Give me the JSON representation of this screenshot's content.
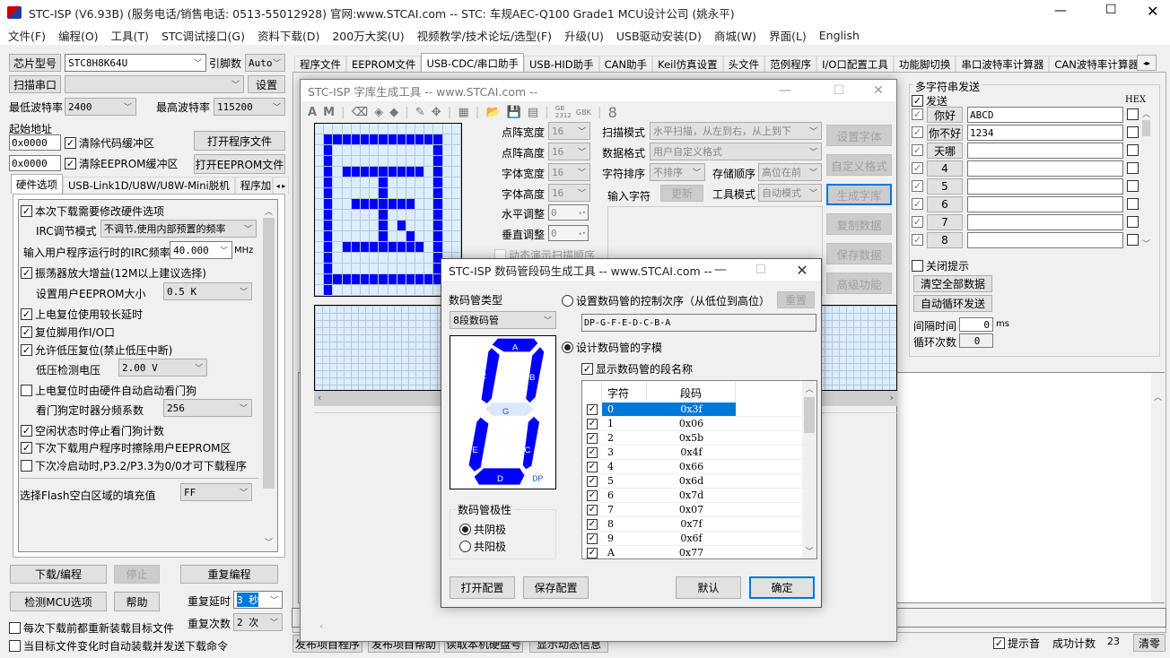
{
  "window": {
    "title": "STC-ISP (V6.93B) (服务电话/销售电话: 0513-55012928) 官网:www.STCAI.com  -- STC: 车规AEC-Q100 Grade1 MCU设计公司 (姚永平)"
  },
  "menu": [
    "文件(F)",
    "编程(O)",
    "工具(T)",
    "STC调试接口(G)",
    "资料下载(D)",
    "200万大奖(U)",
    "视频教学/技术论坛/选型(F)",
    "升级(U)",
    "USB驱动安装(D)",
    "商城(W)",
    "界面(L)",
    "English"
  ],
  "left": {
    "chip_btn": "芯片型号",
    "chip_value": "STC8H8K64U",
    "pins_label": "引脚数",
    "pins_value": "Auto",
    "scan_btn": "扫描串口",
    "port_value": "",
    "settings_btn": "设置",
    "min_baud_label": "最低波特率",
    "min_baud": "2400",
    "max_baud_label": "最高波特率",
    "max_baud": "115200",
    "start_addr_label": "起始地址",
    "addr1": "0x0000",
    "addr2": "0x0000",
    "clear_code": "清除代码缓冲区",
    "clear_eeprom": "清除EEPROM缓冲区",
    "open_prog": "打开程序文件",
    "open_eeprom": "打开EEPROM文件",
    "tabs": [
      "硬件选项",
      "USB-Link1D/U8W/U8W-Mini脱机",
      "程序加"
    ],
    "opt": {
      "o1": "本次下载需要修改硬件选项",
      "irc_mode_label": "IRC调节模式",
      "irc_mode": "不调节,使用内部预置的频率",
      "irc_freq_label": "输入用户程序运行时的IRC频率",
      "irc_freq": "40.000",
      "mhz": "MHz",
      "o2": "振荡器放大增益(12M以上建议选择)",
      "eeprom_label": "设置用户EEPROM大小",
      "eeprom": "0.5 K",
      "o3": "上电复位使用较长延时",
      "o4": "复位脚用作I/O口",
      "o5": "允许低压复位(禁止低压中断)",
      "lv_label": "低压检测电压",
      "lv": "2.00 V",
      "o6": "上电复位时由硬件自动启动看门狗",
      "wdt_label": "看门狗定时器分频系数",
      "wdt": "256",
      "o7": "空闲状态时停止看门狗计数",
      "o8": "下次下载用户程序时擦除用户EEPROM区",
      "o9": "下次冷启动时,P3.2/P3.3为0/0才可下载程序",
      "fill_label": "选择Flash空白区域的填充值",
      "fill": "FF"
    },
    "download": "下载/编程",
    "stop": "停止",
    "repeat_prog": "重复编程",
    "detect": "检测MCU选项",
    "help": "帮助",
    "repeat_delay_label": "重复延时",
    "repeat_delay": "3 秒",
    "repeat_count_label": "重复次数",
    "repeat_count": "2 次",
    "reload": "每次下载前都重新装载目标文件",
    "auto_load": "当目标文件变化时自动装载并发送下载命令"
  },
  "tabs": [
    "程序文件",
    "EEPROM文件",
    "USB-CDC/串口助手",
    "USB-HID助手",
    "CAN助手",
    "Keil仿真设置",
    "头文件",
    "范例程序",
    "I/O口配置工具",
    "功能脚切换",
    "串口波特率计算器",
    "CAN波特率计算器"
  ],
  "multi": {
    "title": "多字符串发送",
    "send": "发送",
    "hex": "HEX",
    "rows": [
      {
        "btn": "你好",
        "value": "ABCD"
      },
      {
        "btn": "你不好",
        "value": "1234"
      },
      {
        "btn": "天哪",
        "value": ""
      },
      {
        "btn": "4",
        "value": ""
      },
      {
        "btn": "5",
        "value": ""
      },
      {
        "btn": "6",
        "value": ""
      },
      {
        "btn": "7",
        "value": ""
      },
      {
        "btn": "8",
        "value": ""
      }
    ],
    "close_tip": "关闭提示",
    "clear_all": "清空全部数据",
    "auto_loop": "自动循环发送",
    "interval_label": "间隔时间",
    "interval": "0",
    "ms": "ms",
    "loop_label": "循环次数",
    "loop": "0"
  },
  "bottom": {
    "b1": "发布项目程序",
    "b2": "发布项目帮助",
    "b3": "读取本机硬盘号",
    "b4": "显示动态信息",
    "beep": "提示音",
    "success_label": "成功计数",
    "success": "23",
    "clear": "清零"
  },
  "font": {
    "title": "STC-ISP 字库生成工具 -- www.STCAI.com --",
    "tb": {
      "gb": "GB 2312",
      "gbk": "GBK"
    },
    "w_label": "点阵宽度",
    "w": "16",
    "h_label": "点阵高度",
    "h": "16",
    "fw_label": "字体宽度",
    "fw": "16",
    "fh_label": "字体高度",
    "fh": "16",
    "hadj_label": "水平调整",
    "hadj": "0",
    "vadj_label": "垂直调整",
    "vadj": "0",
    "demo": "动态演示扫描顺序",
    "scan_label": "扫描模式",
    "scan": "水平扫描，从左到右，从上到下",
    "fmt_label": "数据格式",
    "fmt": "用户自定义格式",
    "sort_label": "字符排序",
    "sort": "不排序",
    "order_label": "存储顺序",
    "order": "高位在前",
    "input_label": "输入字符",
    "refresh": "更新",
    "mode_label": "工具模式",
    "mode": "自动模式",
    "btns": [
      "设置字体",
      "自定义格式",
      "生成字库",
      "复制数据",
      "保存数据",
      "高级功能"
    ],
    "bitmap": [
      "0000000000000000",
      "0111111111111100",
      "0100000000000100",
      "0100000000000100",
      "0101111111110100",
      "0100000100000100",
      "0100000100000100",
      "0100111111100100",
      "0100000100000100",
      "0100000101000100",
      "0100000100100100",
      "0101111111110100",
      "0100000000000100",
      "0100000000000100",
      "0111111111111100",
      "0100000000000000"
    ]
  },
  "seg": {
    "title": "STC-ISP 数码管段码生成工具 -- www.STCAI.com --",
    "type_label": "数码管类型",
    "type": "8段数码管",
    "order_radio": "设置数码管的控制次序（从低位到高位）",
    "reset": "重置",
    "order": "DP-G-F-E-D-C-B-A",
    "design_radio": "设计数码管的字模",
    "show_names": "显示数码管的段名称",
    "segments": {
      "A": "A",
      "B": "B",
      "C": "C",
      "D": "D",
      "E": "E",
      "F": "F",
      "G": "G",
      "DP": "DP"
    },
    "seg_on": "#0000ff",
    "seg_off": "#dde9fb",
    "col_char": "字符",
    "col_code": "段码",
    "rows": [
      [
        "0",
        "0x3f"
      ],
      [
        "1",
        "0x06"
      ],
      [
        "2",
        "0x5b"
      ],
      [
        "3",
        "0x4f"
      ],
      [
        "4",
        "0x66"
      ],
      [
        "5",
        "0x6d"
      ],
      [
        "6",
        "0x7d"
      ],
      [
        "7",
        "0x07"
      ],
      [
        "8",
        "0x7f"
      ],
      [
        "9",
        "0x6f"
      ],
      [
        "A",
        "0x77"
      ]
    ],
    "polarity": "数码管极性",
    "cathode": "共阴极",
    "anode": "共阳极",
    "open_cfg": "打开配置",
    "save_cfg": "保存配置",
    "default": "默认",
    "ok": "确定"
  }
}
